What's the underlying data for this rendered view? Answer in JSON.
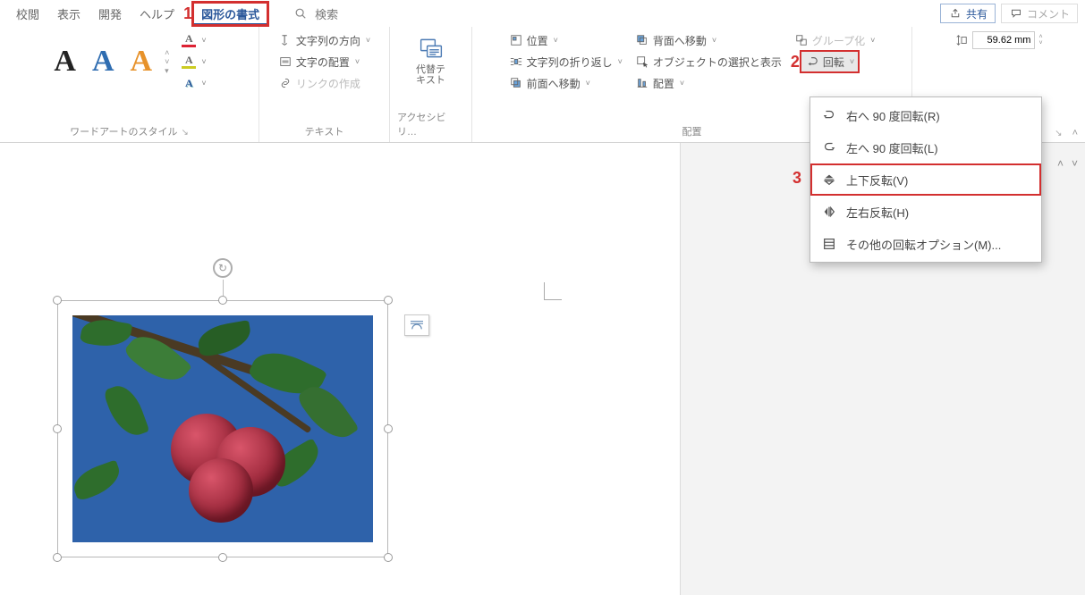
{
  "tabs": {
    "proofreading": "校閲",
    "view": "表示",
    "developer": "開発",
    "help": "ヘルプ",
    "shape_format": "図形の書式",
    "search": "検索"
  },
  "top_right": {
    "share": "共有",
    "comment": "コメント"
  },
  "callouts": {
    "one": "1",
    "two": "2",
    "three": "3"
  },
  "wordart": {
    "sample": "A",
    "group_label": "ワードアートのスタイル"
  },
  "text_group": {
    "text_direction": "文字列の方向",
    "align_text": "文字の配置",
    "create_link": "リンクの作成",
    "group_label": "テキスト"
  },
  "alt_text": {
    "line1": "代替テ",
    "line2": "キスト",
    "group_label": "アクセシビリ…"
  },
  "arrange": {
    "position": "位置",
    "wrap_text": "文字列の折り返し",
    "bring_forward": "前面へ移動",
    "send_backward": "背面へ移動",
    "selection_pane": "オブジェクトの選択と表示",
    "align": "配置",
    "group": "グループ化",
    "rotate": "回転",
    "group_label": "配置"
  },
  "rotate_menu": {
    "right90": "右へ 90 度回転(R)",
    "left90": "左へ 90 度回転(L)",
    "flipV": "上下反転(V)",
    "flipH": "左右反転(H)",
    "more": "その他の回転オプション(M)..."
  },
  "size": {
    "height_value": "59.62 mm"
  }
}
